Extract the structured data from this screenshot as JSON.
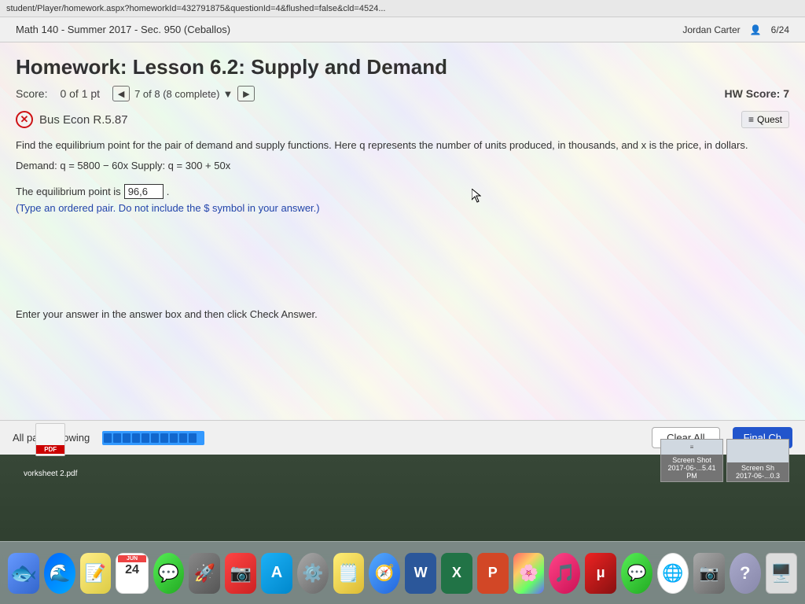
{
  "browser": {
    "url": "student/Player/homework.aspx?homeworkId=432791875&questionId=4&flushed=false&cld=4524...",
    "header_title": "Math 140 - Summer 2017 - Sec. 950 (Ceballos)",
    "user": "Jordan Carter",
    "date": "6/24",
    "hw_score_label": "HW Score: 7"
  },
  "homework": {
    "title": "Homework: Lesson 6.2: Supply and Demand",
    "score_label": "Score:",
    "score_value": "0 of 1 pt",
    "page_indicator": "7 of 8 (8 complete)",
    "hw_score": "HW Score: 7",
    "question_id": "Bus Econ R.5.87",
    "quest_button": "Quest",
    "problem_text": "Find the equilibrium point for the pair of demand and supply functions. Here q represents the number of units produced, in thousands, and x is the price, in dollars.",
    "demand_supply": "Demand: q = 5800 − 60x  Supply: q = 300 + 50x",
    "answer_prefix": "The equilibrium point is",
    "answer_value": "96,6",
    "instruction": "(Type an ordered pair. Do not include the $ symbol in your answer.)",
    "enter_answer_text": "Enter your answer in the answer box and then click Check Answer.",
    "all_parts_label": "All parts showing",
    "clear_all_label": "Clear All",
    "final_check_label": "Final Ch"
  },
  "dock": {
    "cal_month": "JUN",
    "cal_day": "24",
    "items": [
      {
        "name": "finder",
        "label": "Finder"
      },
      {
        "name": "safari-desktop",
        "label": "Safari Desktop"
      },
      {
        "name": "notes",
        "label": "Notes"
      },
      {
        "name": "calendar",
        "label": "Calendar"
      },
      {
        "name": "messages",
        "label": "Messages"
      },
      {
        "name": "launchpad",
        "label": "Launchpad"
      },
      {
        "name": "photos-red",
        "label": "Photos Red"
      },
      {
        "name": "app-store",
        "label": "App Store"
      },
      {
        "name": "system-prefs",
        "label": "System Preferences"
      },
      {
        "name": "sticky-notes",
        "label": "Sticky Notes"
      },
      {
        "name": "safari",
        "label": "Safari"
      },
      {
        "name": "word",
        "label": "Word"
      },
      {
        "name": "excel",
        "label": "Excel"
      },
      {
        "name": "powerpoint",
        "label": "PowerPoint"
      },
      {
        "name": "photos",
        "label": "Photos"
      },
      {
        "name": "itunes",
        "label": "iTunes"
      },
      {
        "name": "utorrent",
        "label": "uTorrent"
      },
      {
        "name": "imessage",
        "label": "iMessage"
      },
      {
        "name": "chrome",
        "label": "Chrome"
      },
      {
        "name": "camera",
        "label": "Camera"
      },
      {
        "name": "help",
        "label": "Help"
      },
      {
        "name": "finder2",
        "label": "Finder2"
      }
    ]
  },
  "desktop": {
    "pdf_icon_label": "PDF",
    "pdf_filename": "vorksheet 2.pdf",
    "screenshot1_label": "Screen Shot",
    "screenshot1_date": "2017-06-...5.41 PM",
    "screenshot2_label": "Screen Sh",
    "screenshot2_date": "2017-06-...0.3"
  }
}
